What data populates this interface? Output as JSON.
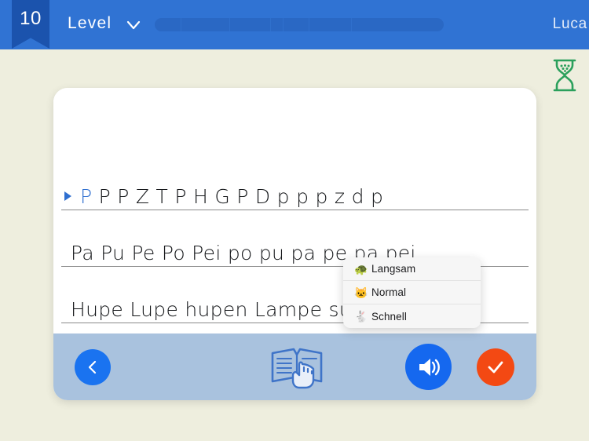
{
  "header": {
    "level_number": "10",
    "level_label": "Level",
    "dropdown_icon": "chevron-down-icon",
    "user_name": "Luca",
    "progress_percent": 0
  },
  "timer": {
    "icon": "hourglass-icon",
    "color": "#2ba05c"
  },
  "exercise": {
    "lines": [
      {
        "highlighted": "P",
        "rest": " P P Z T P H G P D p p p z d p",
        "has_cursor": true
      },
      {
        "highlighted": "",
        "rest": "Pa Pu Pe Po Pei po pu pa pe pa pei",
        "has_cursor": false
      },
      {
        "highlighted": "",
        "rest": "Hupe Lupe hupen Lampe super Lupen",
        "has_cursor": false
      }
    ]
  },
  "speed_menu": {
    "items": [
      {
        "icon": "turtle-icon",
        "emoji": "🐢",
        "label": "Langsam"
      },
      {
        "icon": "cat-face-icon",
        "emoji": "🐱",
        "label": "Normal"
      },
      {
        "icon": "rabbit-icon",
        "emoji": "🐇",
        "label": "Schnell"
      }
    ]
  },
  "toolbar": {
    "back_button": {
      "icon": "chevron-left-icon",
      "color": "#1a73f0"
    },
    "read_along_button": {
      "icon": "book-hand-icon",
      "color": "#3f74c8"
    },
    "speak_button": {
      "icon": "speaker-icon",
      "color": "#1568ef"
    },
    "confirm_button": {
      "icon": "check-icon",
      "color": "#f34913"
    }
  },
  "colors": {
    "header_blue": "#3073d3",
    "badge_blue": "#1b53ad",
    "page_background": "#eeeede",
    "toolbar_blue": "#a9c2de",
    "accent_orange": "#f34913"
  }
}
